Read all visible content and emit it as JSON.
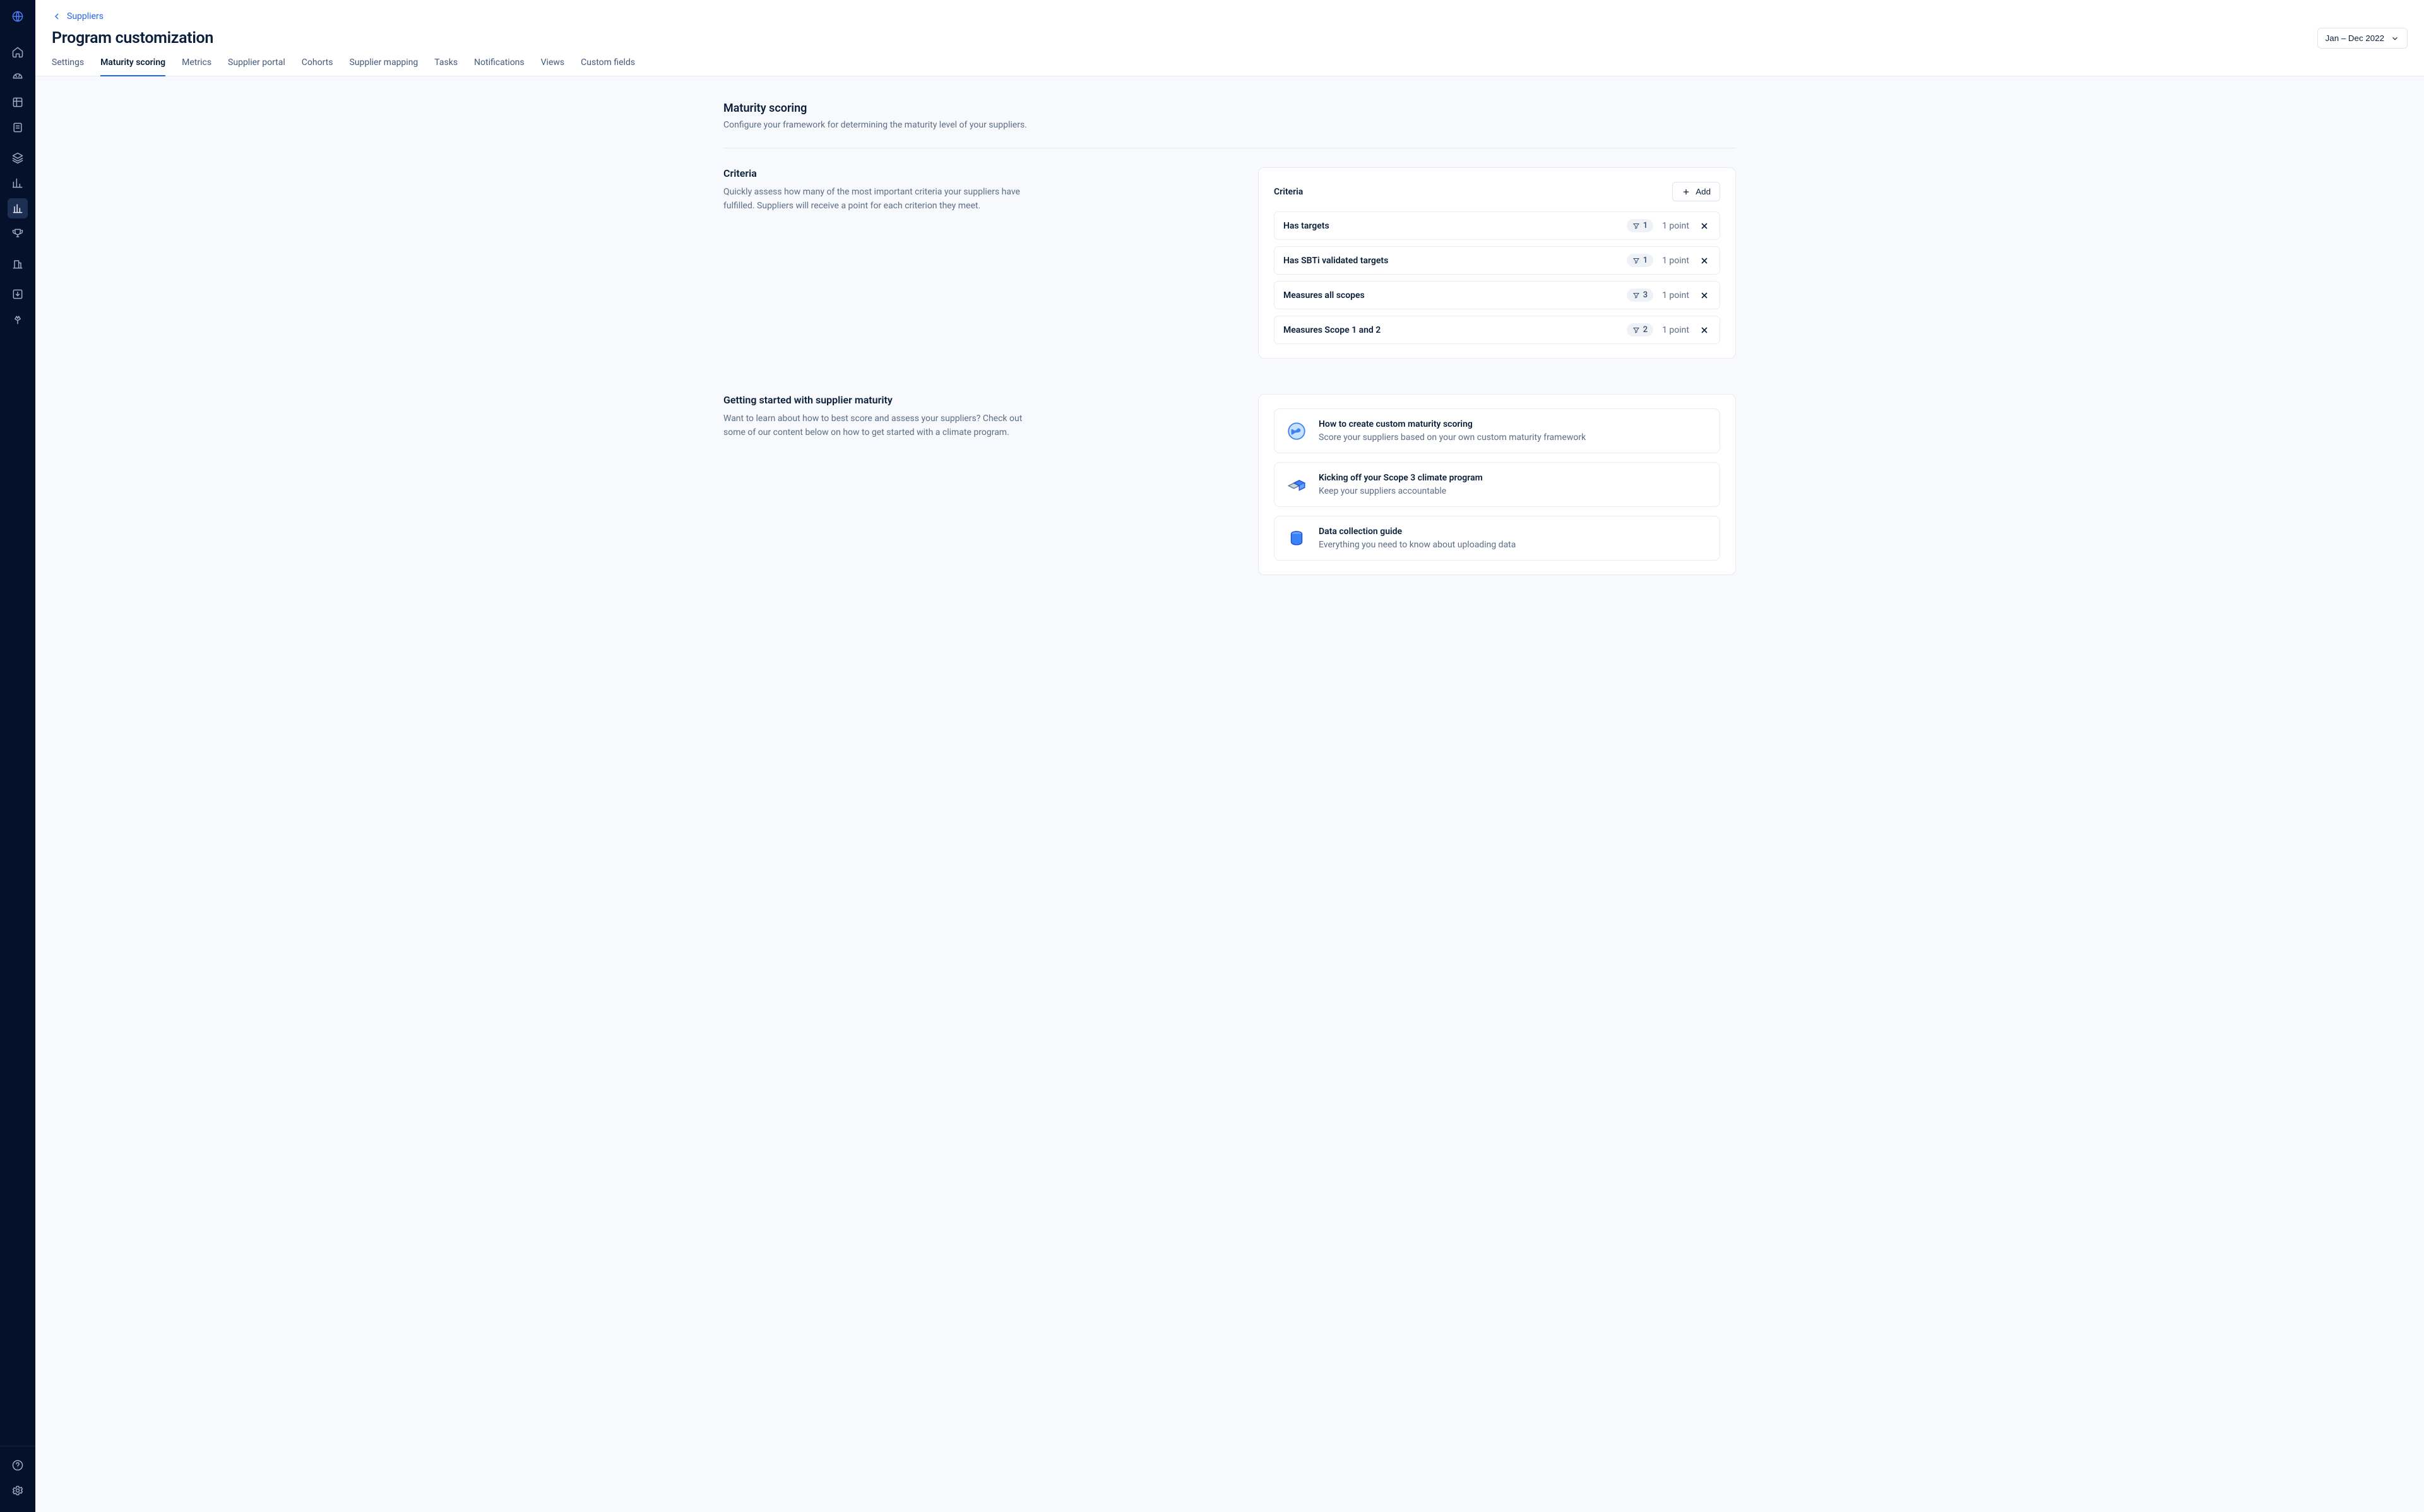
{
  "breadcrumb": {
    "label": "Suppliers"
  },
  "page": {
    "title": "Program customization"
  },
  "period": {
    "label": "Jan – Dec 2022"
  },
  "tabs": [
    {
      "label": "Settings",
      "active": false
    },
    {
      "label": "Maturity scoring",
      "active": true
    },
    {
      "label": "Metrics",
      "active": false
    },
    {
      "label": "Supplier portal",
      "active": false
    },
    {
      "label": "Cohorts",
      "active": false
    },
    {
      "label": "Supplier mapping",
      "active": false
    },
    {
      "label": "Tasks",
      "active": false
    },
    {
      "label": "Notifications",
      "active": false
    },
    {
      "label": "Views",
      "active": false
    },
    {
      "label": "Custom fields",
      "active": false
    }
  ],
  "section": {
    "title": "Maturity scoring",
    "description": "Configure your framework for determining the maturity level of your suppliers."
  },
  "criteria_block": {
    "heading": "Criteria",
    "description": "Quickly assess how many of the most important criteria your suppliers have fulfilled. Suppliers will receive a point for each criterion they meet.",
    "card_title": "Criteria",
    "add_label": "Add",
    "items": [
      {
        "label": "Has targets",
        "filter_count": 1,
        "points": "1 point"
      },
      {
        "label": "Has SBTi validated targets",
        "filter_count": 1,
        "points": "1 point"
      },
      {
        "label": "Measures all scopes",
        "filter_count": 3,
        "points": "1 point"
      },
      {
        "label": "Measures Scope 1 and 2",
        "filter_count": 2,
        "points": "1 point"
      }
    ]
  },
  "getting_started": {
    "heading": "Getting started with supplier maturity",
    "description": "Want to learn about how to best score and assess your suppliers? Check out some of our content below on how to get started with a climate program.",
    "guides": [
      {
        "title": "How to create custom maturity scoring",
        "description": "Score your suppliers based on your own custom maturity framework"
      },
      {
        "title": "Kicking off your Scope 3 climate program",
        "description": "Keep your suppliers accountable"
      },
      {
        "title": "Data collection guide",
        "description": "Everything you need to know about uploading data"
      }
    ]
  }
}
